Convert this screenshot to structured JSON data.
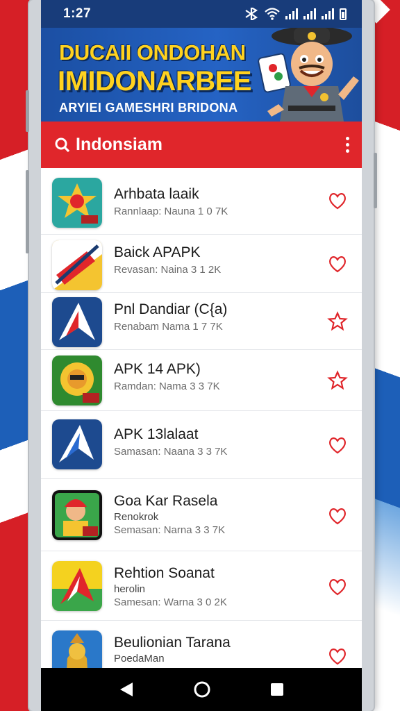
{
  "status_bar": {
    "time": "1:27"
  },
  "banner": {
    "line1": "DUCAII ONDOHAN",
    "line2": "IMIDONARBEE",
    "subtitle": "ARYIEI GAMESHRI BRIDONA"
  },
  "search": {
    "text": "Indonsiam"
  },
  "apps": [
    {
      "name": "Arhbata laaik",
      "developer": "",
      "meta": "Rannlaap:  Nauna 1 0 7K",
      "fav_icon": "heart-outline-icon"
    },
    {
      "name": "Baick APAPK",
      "developer": "",
      "meta": "Revasan:  Naina 3 1 2K",
      "fav_icon": "heart-outline-icon"
    },
    {
      "name": "Pnl Dandiar (C{a)",
      "developer": "",
      "meta": "Renabam  Nama 1 7 7K",
      "fav_icon": "star-outline-icon"
    },
    {
      "name": "APK 14 APK)",
      "developer": "",
      "meta": "Ramdan:  Nama 3 3 7K",
      "fav_icon": "star-outline-icon"
    },
    {
      "name": "APK 13lalaat",
      "developer": "",
      "meta": "Samasan:  Naana 3 3 7K",
      "fav_icon": "heart-outline-icon"
    },
    {
      "name": "Goa Kar Rasela",
      "developer": "Renokrok",
      "meta": "Semasan:  Narna 3 3 7K",
      "fav_icon": "heart-outline-icon"
    },
    {
      "name": "Rehtion Soanat",
      "developer": "herolin",
      "meta": "Samesan:  Warna 3 0 2K",
      "fav_icon": "heart-outline-icon"
    },
    {
      "name": "Beulionian Tarana",
      "developer": "PoedaMan",
      "meta": "",
      "fav_icon": "heart-outline-icon"
    }
  ],
  "colors": {
    "status_bar": "#183c7a",
    "banner": "#2563c4",
    "banner_text": "#ffd21f",
    "search_bar": "#e0262b",
    "accent_icon": "#e0262b"
  },
  "nav": {
    "back_icon": "back-triangle-icon",
    "home_icon": "home-circle-icon",
    "recents_icon": "recents-square-icon"
  }
}
